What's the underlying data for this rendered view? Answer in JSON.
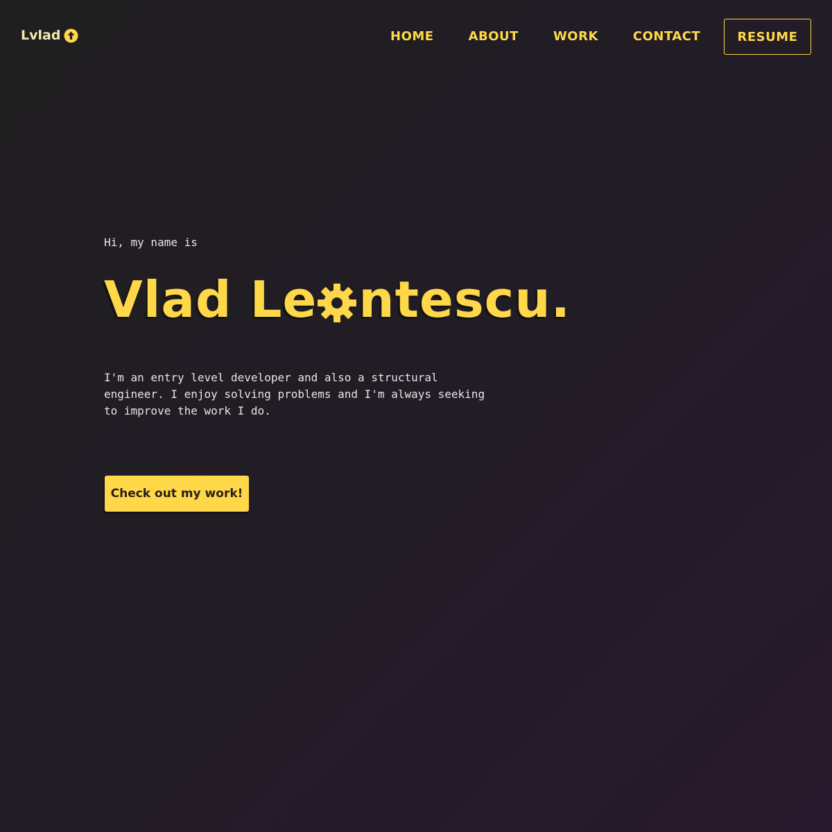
{
  "nav": {
    "logo_text": "Lvlad",
    "logo_icon": "arrow-up-circle-icon",
    "links": [
      "HOME",
      "ABOUT",
      "WORK",
      "CONTACT"
    ],
    "resume_label": "RESUME"
  },
  "hero": {
    "greeting": "Hi, my name is",
    "name_before_gear": "Vlad Le",
    "name_after_gear": "ntescu.",
    "gear_icon": "gear-icon",
    "bio": "I'm an entry level developer and also a structural engineer. I enjoy solving problems and I'm always seeking to improve the work I do.",
    "cta_label": "Check out my work!"
  },
  "colors": {
    "background": "#221c26",
    "accent": "#ffd84a",
    "text": "#e8e6e3",
    "button_text": "#2a1f1a"
  }
}
